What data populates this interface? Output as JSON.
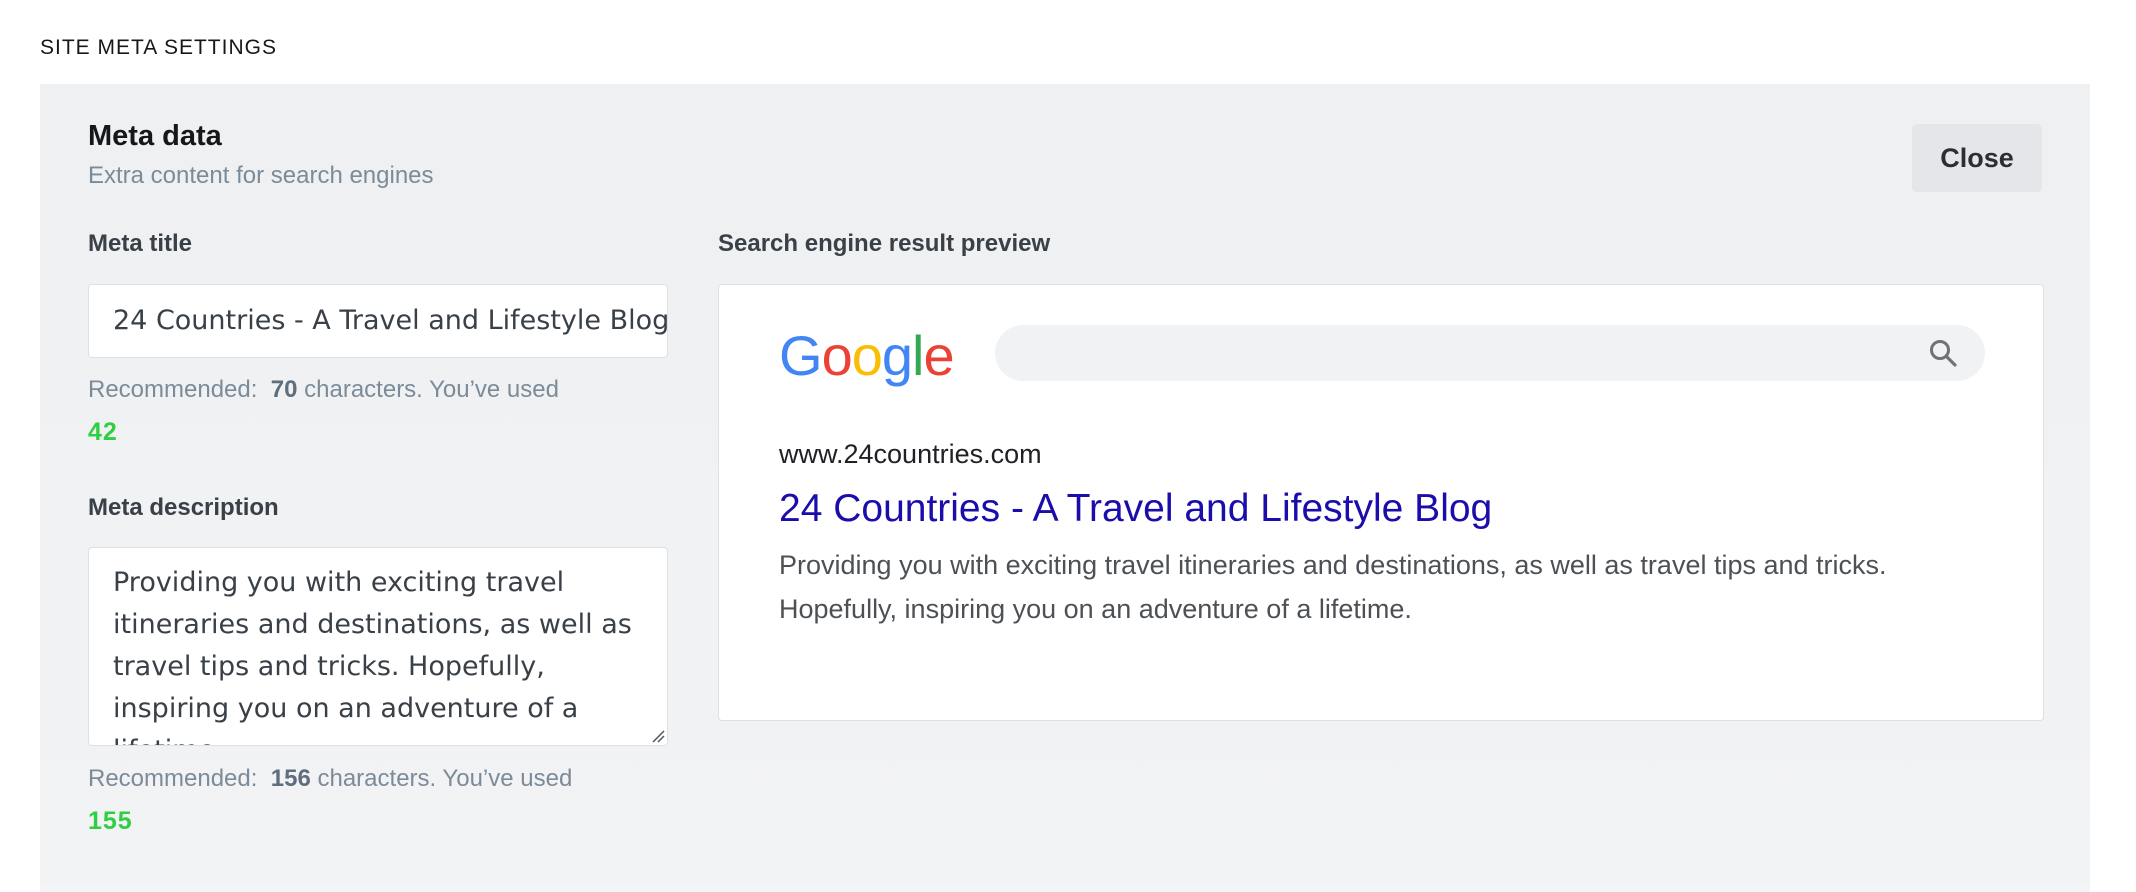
{
  "section": {
    "title": "SITE META SETTINGS"
  },
  "panel": {
    "heading": "Meta data",
    "subheading": "Extra content for search engines",
    "close_label": "Close"
  },
  "meta_title": {
    "label": "Meta title",
    "value": "24 Countries - A Travel and Lifestyle Blog",
    "hint_prefix": "Recommended:",
    "recommended": "70",
    "hint_suffix": "characters. You’ve used",
    "used": "42"
  },
  "meta_description": {
    "label": "Meta description",
    "value": "Providing you with exciting travel itineraries and destinations, as well as travel tips and tricks. Hopefully, inspiring you on an adventure of a lifetime.",
    "hint_prefix": "Recommended:",
    "recommended": "156",
    "hint_suffix": "characters. You’ve used",
    "used": "155"
  },
  "preview": {
    "label": "Search engine result preview",
    "logo": {
      "letters": [
        "G",
        "o",
        "o",
        "g",
        "l",
        "e"
      ],
      "colors": [
        "#4285f4",
        "#ea4335",
        "#fbbc05",
        "#4285f4",
        "#34a853",
        "#ea4335"
      ]
    },
    "search_icon": "magnifier-icon",
    "url": "www.24countries.com",
    "title": "24 Countries - A Travel and Lifestyle Blog",
    "description": "Providing you with exciting travel itineraries and destinations, as well as travel tips and tricks. Hopefully, inspiring you on an adventure of a lifetime."
  },
  "colors": {
    "used_count": "#30cf43",
    "result_title": "#1a0dab",
    "panel_bg": "#eef0f2"
  }
}
